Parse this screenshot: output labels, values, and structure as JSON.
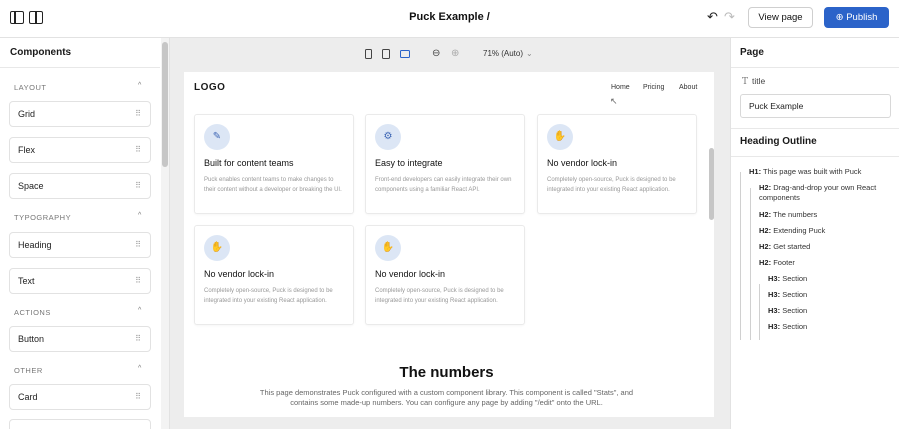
{
  "header": {
    "title": "Puck Example /",
    "view_page": "View page",
    "publish": "Publish",
    "publish_icon": "⊕",
    "undo_icon": "↶",
    "redo_icon": "↷"
  },
  "left": {
    "title": "Components",
    "categories": [
      {
        "label": "LAYOUT",
        "items": [
          "Grid",
          "Flex",
          "Space"
        ]
      },
      {
        "label": "TYPOGRAPHY",
        "items": [
          "Heading",
          "Text"
        ]
      },
      {
        "label": "ACTIONS",
        "items": [
          "Button"
        ]
      },
      {
        "label": "OTHER",
        "items": [
          "Card"
        ]
      }
    ],
    "chevron": "^",
    "grip": "⠿"
  },
  "toolbar": {
    "zoom_out": "⊖",
    "zoom_in": "⊕",
    "zoom_value": "71% (Auto)",
    "chevron": "⌄"
  },
  "canvas": {
    "logo": "LOGO",
    "nav": [
      "Home",
      "Pricing",
      "About"
    ],
    "cards": [
      {
        "icon": "✎",
        "title": "Built for content teams",
        "desc": "Puck enables content teams to make changes to their content without a developer or breaking the UI."
      },
      {
        "icon": "⚙",
        "title": "Easy to integrate",
        "desc": "Front-end developers can easily integrate their own components using a familiar React API."
      },
      {
        "icon": "✋",
        "title": "No vendor lock-in",
        "desc": "Completely open-source, Puck is designed to be integrated into your existing React application."
      },
      {
        "icon": "✋",
        "title": "No vendor lock-in",
        "desc": "Completely open-source, Puck is designed to be integrated into your existing React application."
      },
      {
        "icon": "✋",
        "title": "No vendor lock-in",
        "desc": "Completely open-source, Puck is designed to be integrated into your existing React application."
      }
    ],
    "section_title": "The numbers",
    "section_desc": "This page demonstrates Puck configured with a custom component library. This component is called \"Stats\", and contains some made-up numbers. You can configure any page by adding \"/edit\" onto the URL."
  },
  "right": {
    "page_title": "Page",
    "field_label": "title",
    "field_icon": "T",
    "field_value": "Puck Example",
    "outline_title": "Heading Outline",
    "outline": [
      {
        "level": "H1:",
        "text": "This page was built with Puck"
      },
      {
        "level": "H2:",
        "text": "Drag-and-drop your own React components"
      },
      {
        "level": "H2:",
        "text": "The numbers"
      },
      {
        "level": "H2:",
        "text": "Extending Puck"
      },
      {
        "level": "H2:",
        "text": "Get started"
      },
      {
        "level": "H2:",
        "text": "Footer"
      },
      {
        "level": "H3:",
        "text": "Section"
      },
      {
        "level": "H3:",
        "text": "Section"
      },
      {
        "level": "H3:",
        "text": "Section"
      },
      {
        "level": "H3:",
        "text": "Section"
      }
    ]
  }
}
